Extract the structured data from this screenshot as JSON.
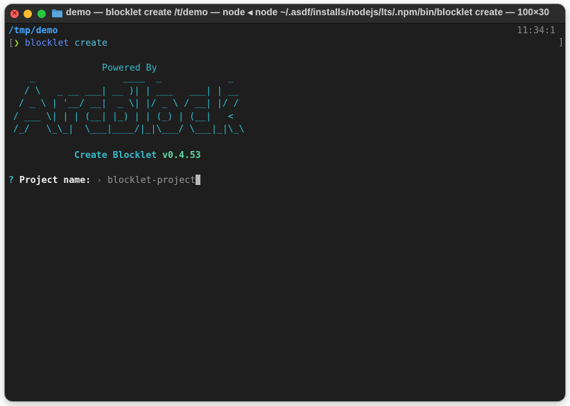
{
  "window": {
    "title": "demo — blocklet create /t/demo — node ◂ node ~/.asdf/installs/nodejs/lts/.npm/bin/blocklet create — 100×30"
  },
  "terminal": {
    "cwd": "/tmp/demo",
    "clock": "11:34:1",
    "prompt": {
      "left_bracket": "[",
      "chevron": "❯",
      "command": "blocklet",
      "argument": "create",
      "right_bracket": "]"
    },
    "powered_by": "Powered By",
    "ascii_logo": "   _                ____  _            _    \n  / \\   _ __ ___| __ )| | ___   ___| | __\n / _ \\ | '__/ __|  _ \\| |/ _ \\ / __| |/ /\n/ ___ \\| | | (__| |_) | | (_) | (__|   < \n/_/   \\_\\_|  \\___|____/|_|\\___/ \\___|_|\\_\\",
    "create_label": "Create Blocklet ",
    "version": "v0.4.53",
    "question": {
      "mark": "?",
      "label": "Project name:",
      "arrow": "›",
      "value": "blocklet-project"
    }
  },
  "colors": {
    "background": "#1e1e1e",
    "titlebar": "#2c2c2c",
    "cwd": "#3fa6ff",
    "logo": "#2fbfd0",
    "chevron": "#9ece2a",
    "version": "#5fd7a8"
  },
  "icons": {
    "close": "close-traffic-light",
    "minimize": "minimize-traffic-light",
    "maximize": "maximize-traffic-light",
    "folder": "folder-icon"
  }
}
